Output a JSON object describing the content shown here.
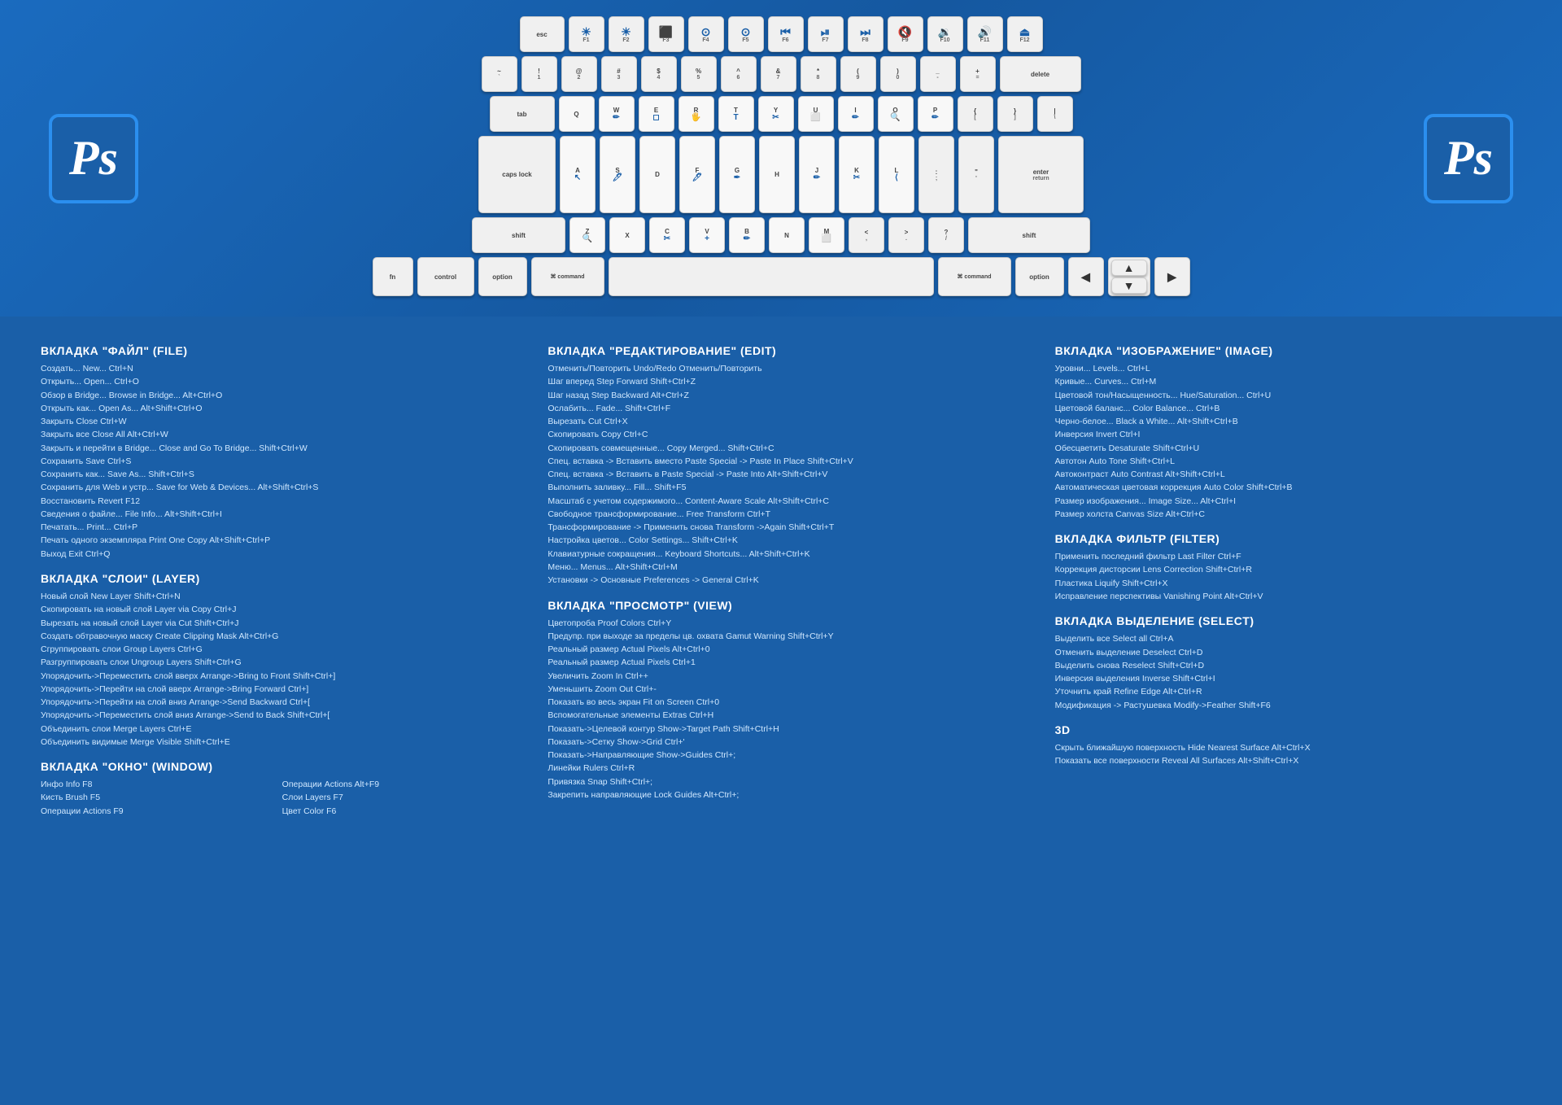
{
  "ps_logo": "Ps",
  "keyboard": {
    "rows": [
      {
        "id": "row-fn",
        "keys": [
          {
            "id": "esc",
            "label": "esc",
            "width": "normal"
          },
          {
            "id": "f1",
            "icon": "☀",
            "sub": "F1",
            "width": "normal"
          },
          {
            "id": "f2",
            "icon": "☀",
            "sub": "F2",
            "width": "normal"
          },
          {
            "id": "f3",
            "icon": "⊞",
            "sub": "F3",
            "width": "normal"
          },
          {
            "id": "f4",
            "icon": "⊙",
            "sub": "F4",
            "width": "normal"
          },
          {
            "id": "f5",
            "icon": "",
            "sub": "F5",
            "width": "normal"
          },
          {
            "id": "f6",
            "icon": "◀◀",
            "sub": "F6",
            "width": "normal"
          },
          {
            "id": "f7",
            "icon": "▶⏎",
            "sub": "F7",
            "width": "normal"
          },
          {
            "id": "f8",
            "icon": "▶▶",
            "sub": "F8",
            "width": "normal"
          },
          {
            "id": "f9",
            "icon": "◀",
            "sub": "F9",
            "width": "normal"
          },
          {
            "id": "f10",
            "icon": "🔊",
            "sub": "F10",
            "width": "normal"
          },
          {
            "id": "f11",
            "icon": "🔊+",
            "sub": "F11",
            "width": "normal"
          },
          {
            "id": "f12",
            "icon": "⏏",
            "sub": "F12",
            "width": "normal"
          }
        ]
      }
    ]
  },
  "sections": {
    "file": {
      "title": "ВКЛАДКА \"ФАЙЛ\" (FILE)",
      "items": [
        "Создать...  New...   Ctrl+N",
        "Открыть...   Open...   Ctrl+O",
        "Обзор в Bridge...  Browse in Bridge...  Alt+Ctrl+O",
        "Открыть как...   Open As...  Alt+Shift+Ctrl+O",
        "Закрыть   Close   Ctrl+W",
        "Закрыть все  Close All   Alt+Ctrl+W",
        "Закрыть и перейти в Bridge...  Close and Go To Bridge...   Shift+Ctrl+W",
        "Сохранить  Save   Ctrl+S",
        "Сохранить как...   Save As...  Shift+Ctrl+S",
        "Сохранить для Web и устр...  Save for Web & Devices...   Alt+Shift+Ctrl+S",
        "Восстановить  Revert  F12",
        "Сведения о файле...  File Info...  Alt+Shift+Ctrl+I",
        "Печатать...   Print...   Ctrl+P",
        "Печать одного экземпляра   Print One Copy  Alt+Shift+Ctrl+P",
        "Выход  Exit   Ctrl+Q"
      ]
    },
    "layer": {
      "title": "ВКЛАДКА \"СЛОИ\" (LAYER)",
      "items": [
        "Новый слой  New Layer    Shift+Ctrl+N",
        "Скопировать на новый слой  Layer via Copy   Ctrl+J",
        "Вырезать на новый слой   Layer via Cut  Shift+Ctrl+J",
        "Создать обтравочную маску  Create Clipping Mask   Alt+Ctrl+G",
        "Сгруппировать слои  Group Layers    Ctrl+G",
        "Разгруппировать слои   Ungroup Layers  Shift+Ctrl+G",
        "Упорядочить->Переместить слой вверх  Arrange->Bring to Front   Shift+Ctrl+]",
        "Упорядочить->Перейти на слой вверх   Arrange->Bring Forward   Ctrl+]",
        "Упорядочить->Перейти на слой вниз  Arrange->Send Backward   Ctrl+[",
        "Упорядочить->Переместить слой вниз   Arrange->Send to Back  Shift+Ctrl+[",
        "Объединить слои  Merge Layers   Ctrl+E",
        "Объединить видимые   Merge Visible  Shift+Ctrl+E"
      ]
    },
    "window": {
      "title": "ВКЛАДКА \"ОКНО\" (WINDOW)",
      "items": [
        "Инфо   Info  F8",
        "Кисть   Brush  F5",
        "Операции  Actions  F9"
      ],
      "items2": [
        "Операции  Actions  Alt+F9",
        "Слои   Layers  F7",
        "Цвет   Color  F6"
      ]
    },
    "edit": {
      "title": "ВКЛАДКА \"РЕДАКТИРОВАНИЕ\" (EDIT)",
      "items": [
        "Отменить/Повторить   Undo/Redo   Отменить/Повторить",
        "Шаг вперед  Step Forward  Shift+Ctrl+Z",
        "Шаг назад   Step Backward  Alt+Ctrl+Z",
        "Ослабить...   Fade...   Shift+Ctrl+F",
        "Вырезать  Cut   Ctrl+X",
        "Скопировать  Copy   Ctrl+C",
        "Скопировать совмещенные...   Copy Merged...   Shift+Ctrl+C",
        "Спец. вставка -> Вставить вместо  Paste Special -> Paste In Place   Shift+Ctrl+V",
        "Спец. вставка -> Вставить в  Paste Special -> Paste Into  Alt+Shift+Ctrl+V",
        "Выполнить заливку...  Fill...   Shift+F5",
        "Масштаб с учетом содержимого...   Content-Aware Scale  Alt+Shift+Ctrl+C",
        "Свободное трансформирование...   Free Transform   Ctrl+T",
        "Трансформирование -> Применить снова  Transform ->Again  Shift+Ctrl+T",
        "Настройка цветов...  Color Settings...   Shift+Ctrl+K",
        "Клавиатурные сокращения...  Keyboard Shortcuts...   Alt+Shift+Ctrl+K",
        "Меню...   Menus...   Alt+Shift+Ctrl+M",
        "Установки -> Основные Preferences -> General   Ctrl+K"
      ]
    },
    "view": {
      "title": "ВКЛАДКА \"ПРОСМОТР\" (VIEW)",
      "items": [
        "Цветопроба  Proof Colors  Ctrl+Y",
        "Предупр. при выходе за пределы цв. охвата  Gamut Warning  Shift+Ctrl+Y",
        "Реальный размер  Actual Pixels  Alt+Ctrl+0",
        "Реальный размер  Actual Pixels  Ctrl+1",
        "Увеличить   Zoom In   Ctrl++",
        "Уменьшить   Zoom Out   Ctrl+-",
        "Показать во весь экран  Fit on Screen  Ctrl+0",
        "Вспомогательные элементы  Extras   Ctrl+H",
        "Показать->Целевой контур   Show->Target Path  Shift+Ctrl+H",
        "Показать->Сетку   Show->Grid   Ctrl+'",
        "Показать->Направляющие   Show->Guides   Ctrl+;",
        "Линейки  Rulers   Ctrl+R",
        "Привязка  Snap   Shift+Ctrl+;",
        "Закрепить направляющие  Lock Guides  Alt+Ctrl+;"
      ]
    },
    "image": {
      "title": "ВКЛАДКА \"ИЗОБРАЖЕНИЕ\" (IMAGE)",
      "items": [
        "Уровни...   Levels...   Ctrl+L",
        "Кривые...   Curves...   Ctrl+M",
        "Цветовой тон/Насыщенность...  Hue/Saturation...    Ctrl+U",
        "Цветовой баланс...   Color Balance...   Ctrl+B",
        "Черно-белое...   Black a White...   Alt+Shift+Ctrl+B",
        "Инверсия  Invert   Ctrl+I",
        "Обесцветить   Desaturate    Shift+Ctrl+U",
        "Автотон   Auto Tone  Shift+Ctrl+L",
        "Автоконтраст   Auto Contrast    Alt+Shift+Ctrl+L",
        "Автоматическая цветовая коррекция  Auto Color  Shift+Ctrl+B",
        "Размер изображения...   Image Size...   Alt+Ctrl+I",
        "Размер холста  Canvas Size  Alt+Ctrl+C"
      ]
    },
    "filter": {
      "title": "ВКЛАДКА ФИЛЬТР (FILTER)",
      "items": [
        "Применить последний фильтр  Last Filter   Ctrl+F",
        "Коррекция дисторсии   Lens Correction  Shift+Ctrl+R",
        "Пластика  Liquify   Shift+Ctrl+X",
        "Исправление перспективы   Vanishing Point  Alt+Ctrl+V"
      ]
    },
    "select": {
      "title": "ВКЛАДКА ВЫДЕЛЕНИЕ (SELECT)",
      "items": [
        "Выделить все   Select all   Ctrl+A",
        "Отменить выделение   Deselect   Ctrl+D",
        "Выделить снова   Reselect    Shift+Ctrl+D",
        "Инверсия выделения   Inverse  Shift+Ctrl+I",
        "Уточнить край   Refine Edge   Alt+Ctrl+R",
        "Модификация -> Растушевка    Modify->Feather    Shift+F6"
      ]
    },
    "3d": {
      "title": "3D",
      "items": [
        "Скрыть ближайшую поверхность   Hide Nearest Surface  Alt+Ctrl+X",
        "Показать все поверхности  Reveal All Surfaces    Alt+Shift+Ctrl+X"
      ]
    }
  }
}
